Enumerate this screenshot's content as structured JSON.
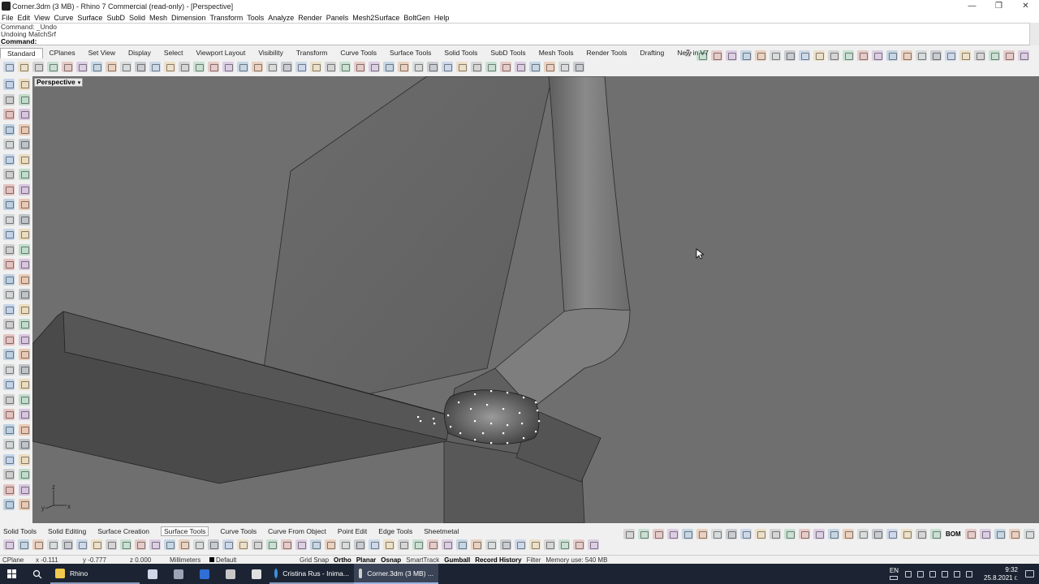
{
  "window": {
    "title": "Corner.3dm (3 MB) - Rhino 7 Commercial (read-only) - [Perspective]",
    "minimize": "—",
    "restore": "❐",
    "close": "✕"
  },
  "menu": [
    "File",
    "Edit",
    "View",
    "Curve",
    "Surface",
    "SubD",
    "Solid",
    "Mesh",
    "Dimension",
    "Transform",
    "Tools",
    "Analyze",
    "Render",
    "Panels",
    "Mesh2Surface",
    "BoltGen",
    "Help"
  ],
  "command": {
    "history": [
      "Command: _Undo",
      "Undoing MatchSrf"
    ],
    "prompt": "Command:"
  },
  "toolbar_tabs": [
    "Standard",
    "CPlanes",
    "Set View",
    "Display",
    "Select",
    "Viewport Layout",
    "Visibility",
    "Transform",
    "Curve Tools",
    "Surface Tools",
    "Solid Tools",
    "SubD Tools",
    "Mesh Tools",
    "Render Tools",
    "Drafting",
    "New in V7"
  ],
  "active_toolbar_tab": "Standard",
  "viewport": {
    "label": "Perspective",
    "background": "#6f6f6f",
    "axes": {
      "x": "x",
      "y": "y",
      "z": "z"
    }
  },
  "bottom_tabs": [
    "Solid Tools",
    "Solid Editing",
    "Surface Creation",
    "Surface Tools",
    "Curve Tools",
    "Curve From Object",
    "Point Edit",
    "Edge Tools",
    "Sheetmetal"
  ],
  "active_bottom_tab": "Surface Tools",
  "bottom_right_label": "BOM",
  "status": {
    "cplane": "CPlane",
    "x": "x -0.111",
    "y": "y -0.777",
    "z": "z 0.000",
    "units": "Millimeters",
    "layer": "Default",
    "grid_snap": "Grid Snap",
    "ortho": "Ortho",
    "planar": "Planar",
    "osnap": "Osnap",
    "smarttrack": "SmartTrack",
    "gumball": "Gumball",
    "record_history": "Record History",
    "filter": "Filter",
    "memory": "Memory use: 540 MB"
  },
  "taskbar": {
    "items": [
      {
        "label": "Rhino",
        "state": "open"
      },
      {
        "label": "Cristina Rus - Inima...",
        "state": "open"
      },
      {
        "label": "Corner.3dm (3 MB) ...",
        "state": "active"
      }
    ],
    "lang": "EN",
    "time": "9:32",
    "date": "25.8.2021 г."
  },
  "colors": {
    "accent": "#e8383d",
    "taskbar": "#1c2433"
  }
}
